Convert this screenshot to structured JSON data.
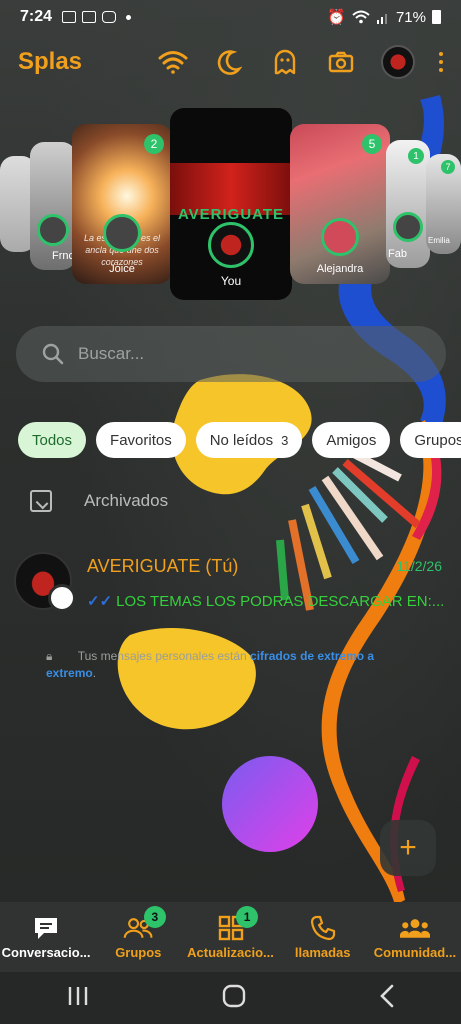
{
  "status_bar": {
    "time": "7:24",
    "battery": "71%"
  },
  "header": {
    "title": "Splas",
    "icons": [
      "wifi-icon",
      "moon-icon",
      "ghost-icon",
      "camera-icon",
      "profile-avatar",
      "more-vert-icon"
    ],
    "accent": "#f0a01c"
  },
  "stories": [
    {
      "name": "",
      "badge": ""
    },
    {
      "name": "Frnc",
      "badge": ""
    },
    {
      "name": "Joice",
      "badge": "2",
      "caption": "La esperanza es el ancla que une dos corazones"
    },
    {
      "name": "You",
      "badge": "",
      "title": "AVERIGUATE"
    },
    {
      "name": "Alejandra",
      "badge": "5"
    },
    {
      "name": "Fab",
      "badge": "1"
    },
    {
      "name": "Emilia",
      "badge": "7"
    }
  ],
  "search": {
    "placeholder": "Buscar..."
  },
  "filters": [
    {
      "label": "Todos",
      "count": ""
    },
    {
      "label": "Favoritos",
      "count": ""
    },
    {
      "label": "No leídos",
      "count": "3"
    },
    {
      "label": "Amigos",
      "count": ""
    },
    {
      "label": "Grupos",
      "count": ""
    }
  ],
  "archived_label": "Archivados",
  "chat": {
    "name": "AVERIGUATE (Tú)",
    "date": "11/2/26",
    "preview": "LOS TEMAS LOS PODRAS DESCARGAR EN:..."
  },
  "encryption": {
    "text": "Tus mensajes personales están ",
    "link": "cifrados de extremo a extremo",
    "end": "."
  },
  "fab_label": "+",
  "bottom_nav": [
    {
      "label": "Conversacio...",
      "badge": ""
    },
    {
      "label": "Grupos",
      "badge": "3"
    },
    {
      "label": "Actualizacio...",
      "badge": "1"
    },
    {
      "label": "llamadas",
      "badge": ""
    },
    {
      "label": "Comunidad...",
      "badge": ""
    }
  ],
  "colors": {
    "accent": "#f0a01c",
    "green": "#2ec26a",
    "link": "#3a8ee6"
  }
}
